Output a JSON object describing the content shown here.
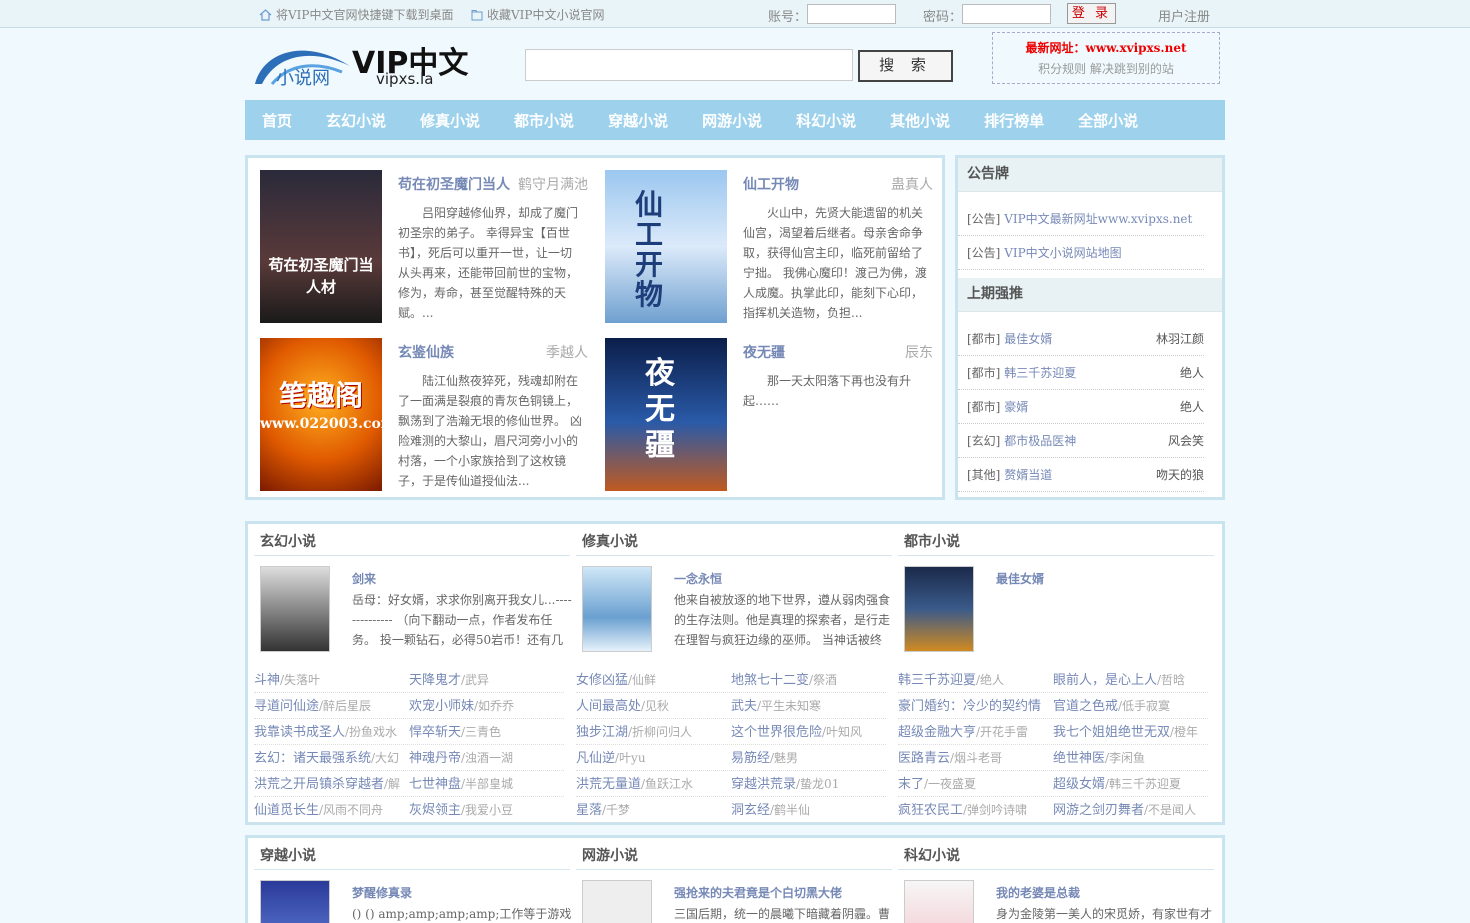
{
  "topbar": {
    "shortcut_text": "将VIP中文官网快捷键下载到桌面",
    "favorite_text": "收藏VIP中文小说官网",
    "account_label": "账号：",
    "password_label": "密码：",
    "login_label": "登 录",
    "register_label": "用户注册"
  },
  "logo": {
    "cn": "VIP中文",
    "sub": "vipxs.la",
    "badge": "小说网"
  },
  "search": {
    "button_label": "搜 索",
    "placeholder": ""
  },
  "notice": {
    "prefix": "最新网址：",
    "url": "www.xvipxs.net",
    "line2": "积分规则  解决跳到别的站"
  },
  "nav": [
    "首页",
    "玄幻小说",
    "修真小说",
    "都市小说",
    "穿越小说",
    "网游小说",
    "科幻小说",
    "其他小说",
    "排行榜单",
    "全部小说"
  ],
  "featured": [
    {
      "title": "苟在初圣魔门当人",
      "author": "鹤守月满池",
      "desc": "吕阳穿越修仙界，却成了魔门初圣宗的弟子。 幸得异宝【百世书】，死后可以重开一世，让一切从头再来，还能带回前世的宝物，修为，寿命，甚至觉醒特殊的天赋。...",
      "cover_text": "苟在初圣魔门当人材"
    },
    {
      "title": "仙工开物",
      "author": "蛊真人",
      "desc": "火山中，先贤大能遗留的机关仙宫，渴望着后继者。母亲舍命争取，获得仙宫主印，临死前留给了宁拙。 我佛心魔印！渡己为佛，渡人成魔。执掌此印，能刻下心印，指挥机关造物，负担...",
      "cover_text": "仙工开物"
    },
    {
      "title": "玄鉴仙族",
      "author": "季越人",
      "desc": "陆江仙熬夜猝死，残魂却附在了一面满是裂痕的青灰色铜镜上，飘荡到了浩瀚无垠的修仙世界。 凶险难测的大黎山，眉尺河旁小小的村落，一个小家族拾到了这枚镜子，于是传仙道授仙法...",
      "cover_text": "笔趣阁",
      "cover_url": "www.022003.com"
    },
    {
      "title": "夜无疆",
      "author": "辰东",
      "desc": "那一天太阳落下再也没有升起……",
      "cover_text": "夜无疆"
    }
  ],
  "sidebar": {
    "board_title": "公告牌",
    "notices": [
      {
        "tag": "[公告]",
        "text": "VIP中文最新网址www.xvipxs.net"
      },
      {
        "tag": "[公告]",
        "text": "VIP中文小说网站地图"
      }
    ],
    "recommend_title": "上期强推",
    "recommend": [
      {
        "cat": "[都市]",
        "title": "最佳女婿",
        "author": "林羽江颜"
      },
      {
        "cat": "[都市]",
        "title": "韩三千苏迎夏",
        "author": "绝人"
      },
      {
        "cat": "[都市]",
        "title": "豪婿",
        "author": "绝人"
      },
      {
        "cat": "[玄幻]",
        "title": "都市极品医神",
        "author": "风会笑"
      },
      {
        "cat": "[其他]",
        "title": "赘婿当道",
        "author": "吻天的狼"
      }
    ]
  },
  "sections": [
    {
      "name": "玄幻小说",
      "featured": {
        "title": "剑来",
        "desc": "岳母：好女婿，求求你别离开我女儿...-------------- （向下翻动一点，作者发布任务。 投一颗钻石，必得50岩币！还有几率"
      },
      "rows": [
        [
          "斗神",
          "/失落叶",
          "天降鬼才",
          "/武异"
        ],
        [
          "寻道问仙途",
          "/醉后星辰",
          "欢宠小师妹",
          "/如乔乔"
        ],
        [
          "我靠读书成圣人",
          "/扮鱼戏水",
          "悍卒斩天",
          "/三青色"
        ],
        [
          "玄幻：诸天最强系统",
          "/大幻",
          "神魂丹帝",
          "/浊酒一湖"
        ],
        [
          "洪荒之开局镇杀穿越者",
          "/解",
          "七世神盘",
          "/半部皇城"
        ],
        [
          "仙道觅长生",
          "/风雨不同舟",
          "灰烬领主",
          "/我爱小豆"
        ]
      ]
    },
    {
      "name": "修真小说",
      "featured": {
        "title": "一念永恒",
        "desc": "他来自被放逐的地下世界，遵从弱肉强食的生存法则。他是真理的探索者，是行走在理智与疯狂边缘的巫师。 当神话被终"
      },
      "rows": [
        [
          "女修凶猛",
          "/仙鲜",
          "地煞七十二变",
          "/祭酒"
        ],
        [
          "人间最高处",
          "/见秋",
          "武夫",
          "/平生未知寒"
        ],
        [
          "独步江湖",
          "/折柳问归人",
          "这个世界很危险",
          "/叶知风"
        ],
        [
          "凡仙逆",
          "/叶yu",
          "易筋经",
          "/魅男"
        ],
        [
          "洪荒无量道",
          "/鱼跃江水",
          "穿越洪荒录",
          "/蛰龙01"
        ],
        [
          "星落",
          "/千梦",
          "洞玄经",
          "/鹤半仙"
        ]
      ]
    },
    {
      "name": "都市小说",
      "featured": {
        "title": "最佳女婿",
        "desc": ""
      },
      "rows": [
        [
          "韩三千苏迎夏",
          "/绝人",
          "眼前人，是心上人",
          "/哲晗"
        ],
        [
          "豪门婚约：冷少的契约情",
          "",
          "官道之色戒",
          "/低手寂寞"
        ],
        [
          "超级金融大亨",
          "/开花手雷",
          "我七个姐姐绝世无双",
          "/橙年"
        ],
        [
          "医路青云",
          "/烟斗老哥",
          "绝世神医",
          "/李闲鱼"
        ],
        [
          "末了",
          "/一夜盛夏",
          "超级女婿",
          "/韩三千苏迎夏"
        ],
        [
          "疯狂农民工",
          "/弹剑吟诗啸",
          "网游之剑刃舞者",
          "/不是闻人"
        ]
      ]
    },
    {
      "name": "穿越小说",
      "featured": {
        "title": "梦醒修真录",
        "desc": "() () amp;amp;amp;amp;工作等于游戏，游"
      }
    },
    {
      "name": "网游小说",
      "featured": {
        "title": "强抢来的夫君竟是个白切黑大佬",
        "desc": "三国后期，统一的晨曦下暗藏着阴霾。曹"
      }
    },
    {
      "name": "科幻小说",
      "featured": {
        "title": "我的老婆是总裁",
        "desc": "身为金陵第一美人的宋觅娇，有家世有才"
      }
    }
  ]
}
